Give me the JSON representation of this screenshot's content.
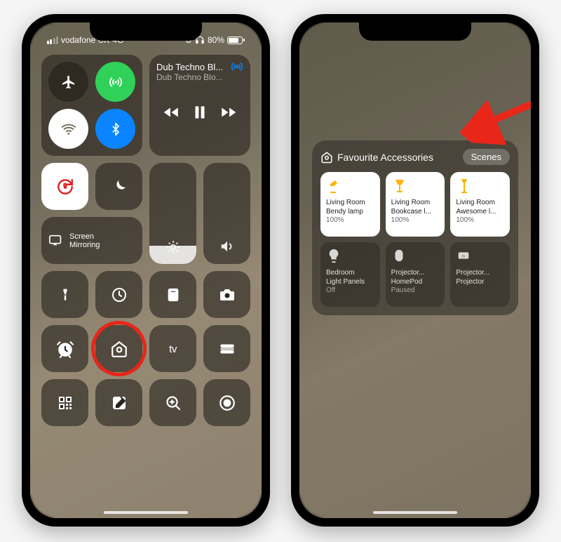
{
  "statusbar": {
    "carrier": "vodafone UK",
    "network": "4G",
    "headphones_connected": true,
    "battery_pct": "80%"
  },
  "media": {
    "title": "Dub Techno Bl...",
    "subtitle": "Dub Techno Blo..."
  },
  "screen_mirroring": "Screen Mirroring",
  "appletv_label": "tv",
  "home_panel": {
    "header": "Favourite Accessories",
    "tab_scenes": "Scenes",
    "accessories": [
      {
        "name_line1": "Living Room",
        "name_line2": "Bendy lamp",
        "status": "100%",
        "on": true,
        "icon": "lamp-desk-icon"
      },
      {
        "name_line1": "Living Room",
        "name_line2": "Bookcase l...",
        "status": "100%",
        "on": true,
        "icon": "lamp-table-icon"
      },
      {
        "name_line1": "Living Room",
        "name_line2": "Awesome l...",
        "status": "100%",
        "on": true,
        "icon": "lamp-floor-icon"
      },
      {
        "name_line1": "Bedroom",
        "name_line2": "Light Panels",
        "status": "Off",
        "on": false,
        "icon": "lightbulb-icon"
      },
      {
        "name_line1": "Projector...",
        "name_line2": "HomePod",
        "status": "Paused",
        "on": false,
        "icon": "homepod-icon"
      },
      {
        "name_line1": "Projector...",
        "name_line2": "Projector",
        "status": "",
        "on": false,
        "icon": "appletv-icon"
      }
    ]
  },
  "icons": {
    "airplane": "airplane-icon",
    "cellular": "cellular-icon",
    "wifi": "wifi-icon",
    "bluetooth": "bluetooth-icon",
    "rotation_lock": "rotation-lock-icon",
    "dnd": "dnd-moon-icon",
    "flashlight": "flashlight-icon",
    "timer": "timer-icon",
    "calculator": "calculator-icon",
    "camera": "camera-icon",
    "alarm": "alarm-clock-icon",
    "home": "home-icon",
    "appletv": "appletv-icon",
    "wallet": "wallet-icon",
    "qr": "qr-code-icon",
    "note": "quick-note-icon",
    "magnifier": "magnifier-icon",
    "screen_record": "screen-record-icon",
    "brightness": "brightness-icon",
    "volume": "volume-icon",
    "screen_mirror": "screen-mirror-icon",
    "prev": "media-prev-icon",
    "pause": "media-pause-icon",
    "next": "media-next-icon"
  },
  "annotations": {
    "red_circle_target": "home-icon",
    "red_arrow_target": "scenes-tab"
  },
  "colors": {
    "green": "#30d158",
    "blue": "#0a84ff",
    "arrow_red": "#e8261a",
    "lamp_yellow": "#ffb300"
  }
}
